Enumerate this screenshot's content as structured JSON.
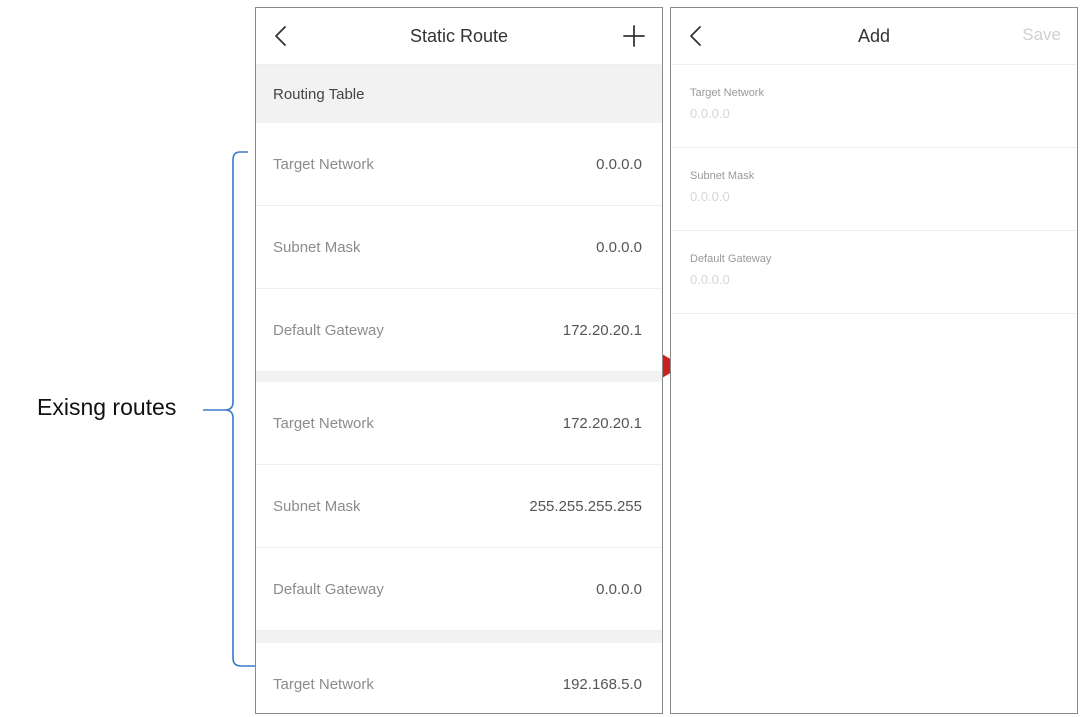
{
  "annotation": {
    "label": "Exisng routes",
    "bracket_color": "#3a78c9",
    "arrow_color": "#cc1f1f"
  },
  "left_screen": {
    "title": "Static Route",
    "back_icon": "chevron-left-icon",
    "add_icon": "plus-icon",
    "section_title": "Routing Table",
    "routes": [
      {
        "target_network": {
          "label": "Target Network",
          "value": "0.0.0.0"
        },
        "subnet_mask": {
          "label": "Subnet Mask",
          "value": "0.0.0.0"
        },
        "default_gateway": {
          "label": "Default Gateway",
          "value": "172.20.20.1"
        }
      },
      {
        "target_network": {
          "label": "Target Network",
          "value": "172.20.20.1"
        },
        "subnet_mask": {
          "label": "Subnet Mask",
          "value": "255.255.255.255"
        },
        "default_gateway": {
          "label": "Default Gateway",
          "value": "0.0.0.0"
        }
      },
      {
        "target_network": {
          "label": "Target Network",
          "value": "192.168.5.0"
        }
      }
    ]
  },
  "right_screen": {
    "title": "Add",
    "back_icon": "chevron-left-icon",
    "save_label": "Save",
    "fields": [
      {
        "label": "Target Network",
        "placeholder": "0.0.0.0",
        "value": ""
      },
      {
        "label": "Subnet Mask",
        "placeholder": "0.0.0.0",
        "value": ""
      },
      {
        "label": "Default Gateway",
        "placeholder": "0.0.0.0",
        "value": ""
      }
    ]
  }
}
